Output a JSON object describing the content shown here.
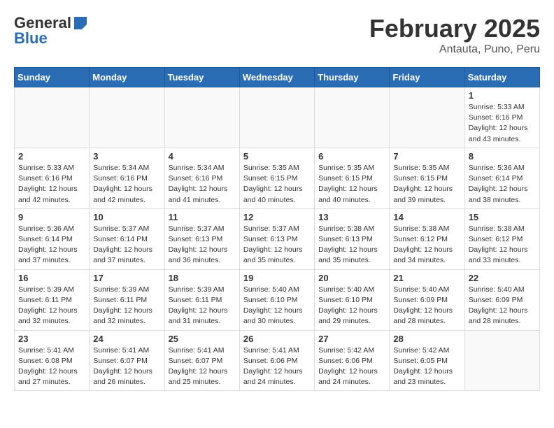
{
  "header": {
    "logo": {
      "line1": "General",
      "line2": "Blue"
    },
    "title": "February 2025",
    "subtitle": "Antauta, Puno, Peru"
  },
  "days_of_week": [
    "Sunday",
    "Monday",
    "Tuesday",
    "Wednesday",
    "Thursday",
    "Friday",
    "Saturday"
  ],
  "weeks": [
    [
      {
        "day": "",
        "info": ""
      },
      {
        "day": "",
        "info": ""
      },
      {
        "day": "",
        "info": ""
      },
      {
        "day": "",
        "info": ""
      },
      {
        "day": "",
        "info": ""
      },
      {
        "day": "",
        "info": ""
      },
      {
        "day": "1",
        "info": "Sunrise: 5:33 AM\nSunset: 6:16 PM\nDaylight: 12 hours\nand 43 minutes."
      }
    ],
    [
      {
        "day": "2",
        "info": "Sunrise: 5:33 AM\nSunset: 6:16 PM\nDaylight: 12 hours\nand 42 minutes."
      },
      {
        "day": "3",
        "info": "Sunrise: 5:34 AM\nSunset: 6:16 PM\nDaylight: 12 hours\nand 42 minutes."
      },
      {
        "day": "4",
        "info": "Sunrise: 5:34 AM\nSunset: 6:16 PM\nDaylight: 12 hours\nand 41 minutes."
      },
      {
        "day": "5",
        "info": "Sunrise: 5:35 AM\nSunset: 6:15 PM\nDaylight: 12 hours\nand 40 minutes."
      },
      {
        "day": "6",
        "info": "Sunrise: 5:35 AM\nSunset: 6:15 PM\nDaylight: 12 hours\nand 40 minutes."
      },
      {
        "day": "7",
        "info": "Sunrise: 5:35 AM\nSunset: 6:15 PM\nDaylight: 12 hours\nand 39 minutes."
      },
      {
        "day": "8",
        "info": "Sunrise: 5:36 AM\nSunset: 6:14 PM\nDaylight: 12 hours\nand 38 minutes."
      }
    ],
    [
      {
        "day": "9",
        "info": "Sunrise: 5:36 AM\nSunset: 6:14 PM\nDaylight: 12 hours\nand 37 minutes."
      },
      {
        "day": "10",
        "info": "Sunrise: 5:37 AM\nSunset: 6:14 PM\nDaylight: 12 hours\nand 37 minutes."
      },
      {
        "day": "11",
        "info": "Sunrise: 5:37 AM\nSunset: 6:13 PM\nDaylight: 12 hours\nand 36 minutes."
      },
      {
        "day": "12",
        "info": "Sunrise: 5:37 AM\nSunset: 6:13 PM\nDaylight: 12 hours\nand 35 minutes."
      },
      {
        "day": "13",
        "info": "Sunrise: 5:38 AM\nSunset: 6:13 PM\nDaylight: 12 hours\nand 35 minutes."
      },
      {
        "day": "14",
        "info": "Sunrise: 5:38 AM\nSunset: 6:12 PM\nDaylight: 12 hours\nand 34 minutes."
      },
      {
        "day": "15",
        "info": "Sunrise: 5:38 AM\nSunset: 6:12 PM\nDaylight: 12 hours\nand 33 minutes."
      }
    ],
    [
      {
        "day": "16",
        "info": "Sunrise: 5:39 AM\nSunset: 6:11 PM\nDaylight: 12 hours\nand 32 minutes."
      },
      {
        "day": "17",
        "info": "Sunrise: 5:39 AM\nSunset: 6:11 PM\nDaylight: 12 hours\nand 32 minutes."
      },
      {
        "day": "18",
        "info": "Sunrise: 5:39 AM\nSunset: 6:11 PM\nDaylight: 12 hours\nand 31 minutes."
      },
      {
        "day": "19",
        "info": "Sunrise: 5:40 AM\nSunset: 6:10 PM\nDaylight: 12 hours\nand 30 minutes."
      },
      {
        "day": "20",
        "info": "Sunrise: 5:40 AM\nSunset: 6:10 PM\nDaylight: 12 hours\nand 29 minutes."
      },
      {
        "day": "21",
        "info": "Sunrise: 5:40 AM\nSunset: 6:09 PM\nDaylight: 12 hours\nand 28 minutes."
      },
      {
        "day": "22",
        "info": "Sunrise: 5:40 AM\nSunset: 6:09 PM\nDaylight: 12 hours\nand 28 minutes."
      }
    ],
    [
      {
        "day": "23",
        "info": "Sunrise: 5:41 AM\nSunset: 6:08 PM\nDaylight: 12 hours\nand 27 minutes."
      },
      {
        "day": "24",
        "info": "Sunrise: 5:41 AM\nSunset: 6:07 PM\nDaylight: 12 hours\nand 26 minutes."
      },
      {
        "day": "25",
        "info": "Sunrise: 5:41 AM\nSunset: 6:07 PM\nDaylight: 12 hours\nand 25 minutes."
      },
      {
        "day": "26",
        "info": "Sunrise: 5:41 AM\nSunset: 6:06 PM\nDaylight: 12 hours\nand 24 minutes."
      },
      {
        "day": "27",
        "info": "Sunrise: 5:42 AM\nSunset: 6:06 PM\nDaylight: 12 hours\nand 24 minutes."
      },
      {
        "day": "28",
        "info": "Sunrise: 5:42 AM\nSunset: 6:05 PM\nDaylight: 12 hours\nand 23 minutes."
      },
      {
        "day": "",
        "info": ""
      }
    ]
  ]
}
